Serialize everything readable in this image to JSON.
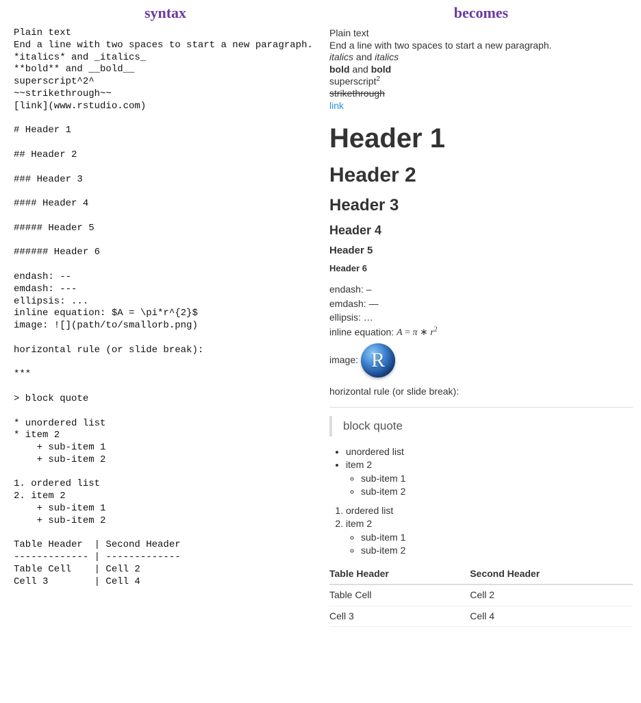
{
  "titles": {
    "left": "syntax",
    "right": "becomes"
  },
  "syntax_raw": "Plain text\nEnd a line with two spaces to start a new paragraph.\n*italics* and _italics_\n**bold** and __bold__\nsuperscript^2^\n~~strikethrough~~\n[link](www.rstudio.com)\n\n# Header 1\n\n## Header 2\n\n### Header 3\n\n#### Header 4\n\n##### Header 5\n\n###### Header 6\n\nendash: --\nemdash: ---\nellipsis: ...\ninline equation: $A = \\pi*r^{2}$\nimage: ![](path/to/smallorb.png)\n\nhorizontal rule (or slide break):\n\n***\n\n> block quote\n\n* unordered list\n* item 2\n    + sub-item 1\n    + sub-item 2\n\n1. ordered list\n2. item 2\n    + sub-item 1\n    + sub-item 2\n\nTable Header  | Second Header\n------------- | -------------\nTable Cell    | Cell 2\nCell 3        | Cell 4",
  "rendered": {
    "plain1": "Plain text",
    "plain2": "End a line with two spaces to start a new paragraph.",
    "italics": "italics",
    "and": " and ",
    "bold": "bold",
    "superscript": "superscript",
    "sup_val": "2",
    "strike": "strikethrough",
    "link_text": "link",
    "h1": "Header 1",
    "h2": "Header 2",
    "h3": "Header 3",
    "h4": "Header 4",
    "h5": "Header 5",
    "h6": "Header 6",
    "endash_label": "endash: ",
    "endash": "–",
    "emdash_label": "emdash: ",
    "emdash": "—",
    "ellipsis_label": "ellipsis: ",
    "ellipsis": "…",
    "eq_label": "inline equation: ",
    "eq_A": "A",
    "eq_eq": " = ",
    "eq_pi": "π",
    "eq_star": " ∗ ",
    "eq_r": "r",
    "eq_pow": "2",
    "image_label": "image: ",
    "r_letter": "R",
    "hr_text": "horizontal rule (or slide break):",
    "blockquote": "block quote",
    "ul": {
      "i1": "unordered list",
      "i2": "item 2",
      "s1": "sub-item 1",
      "s2": "sub-item 2"
    },
    "ol": {
      "i1": "ordered list",
      "i2": "item 2",
      "s1": "sub-item 1",
      "s2": "sub-item 2"
    },
    "table": {
      "h1": "Table Header",
      "h2": "Second Header",
      "r1c1": "Table Cell",
      "r1c2": "Cell 2",
      "r2c1": "Cell 3",
      "r2c2": "Cell 4"
    }
  }
}
